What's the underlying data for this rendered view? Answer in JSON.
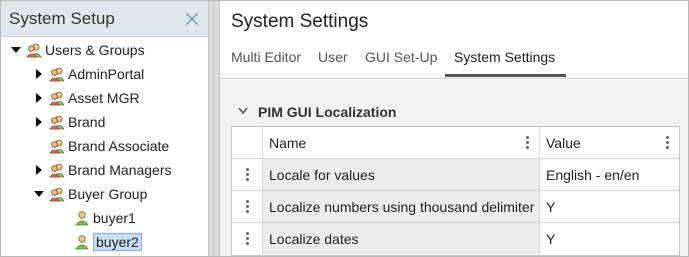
{
  "left_panel": {
    "title": "System Setup",
    "tree": [
      {
        "label": "Users & Groups",
        "kind": "group",
        "expand": "down",
        "level": 0
      },
      {
        "label": "AdminPortal",
        "kind": "group",
        "expand": "right",
        "level": 1
      },
      {
        "label": "Asset MGR",
        "kind": "group",
        "expand": "right",
        "level": 1
      },
      {
        "label": "Brand",
        "kind": "group",
        "expand": "right",
        "level": 1
      },
      {
        "label": "Brand Associate",
        "kind": "group",
        "expand": "none",
        "level": 1
      },
      {
        "label": "Brand Managers",
        "kind": "group",
        "expand": "right",
        "level": 1
      },
      {
        "label": "Buyer Group",
        "kind": "group",
        "expand": "down",
        "level": 1
      },
      {
        "label": "buyer1",
        "kind": "user",
        "expand": "none",
        "level": 2
      },
      {
        "label": "buyer2",
        "kind": "user",
        "expand": "none",
        "level": 2,
        "selected": true
      }
    ]
  },
  "right_panel": {
    "title": "System Settings",
    "tabs": [
      {
        "label": "Multi Editor",
        "active": false
      },
      {
        "label": "User",
        "active": false
      },
      {
        "label": "GUI Set-Up",
        "active": false
      },
      {
        "label": "System Settings",
        "active": true
      }
    ],
    "section": {
      "title": "PIM GUI Localization",
      "columns": [
        "Name",
        "Value"
      ],
      "rows": [
        {
          "name": "Locale for values",
          "value": "English - en/en"
        },
        {
          "name": "Localize numbers using thousand delimiter",
          "value": "Y"
        },
        {
          "name": "Localize dates",
          "value": "Y"
        }
      ]
    }
  },
  "colors": {
    "header_bg": "#dfe7ef",
    "selection": "#c9def2",
    "content_bg": "#f2f2f2"
  }
}
